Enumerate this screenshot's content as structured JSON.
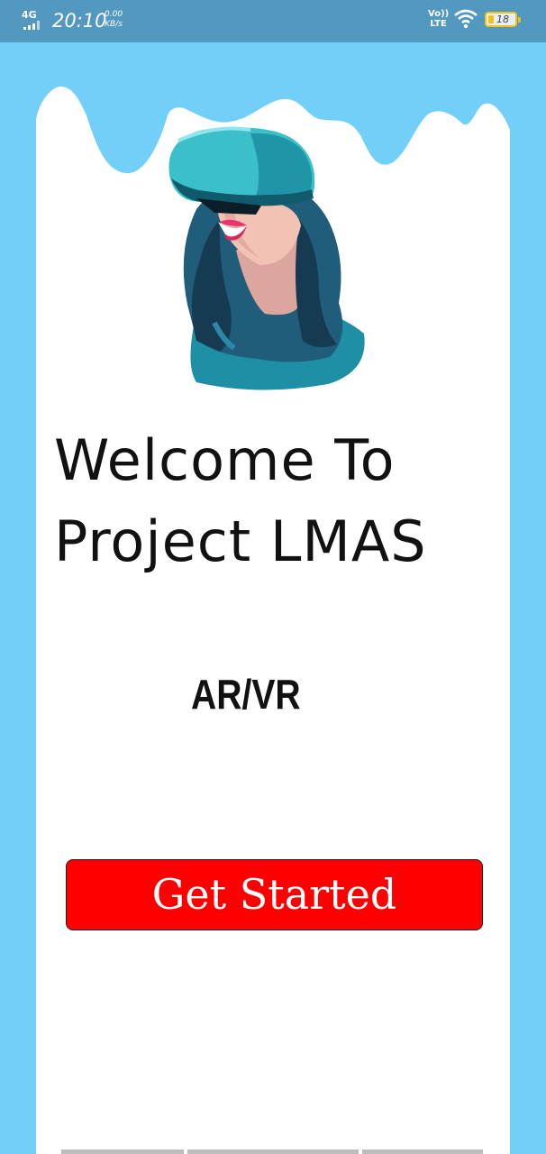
{
  "status_bar": {
    "network": "4G",
    "time": "20:10",
    "speed_value": "0.00",
    "speed_unit": "KB/s",
    "volte_top": "Vo))",
    "volte_bottom": "LTE",
    "battery": "18"
  },
  "main": {
    "title_line1": "Welcome To",
    "title_line2": "Project LMAS",
    "subtitle": "AR/VR",
    "cta_label": "Get Started"
  },
  "colors": {
    "background": "#71cff8",
    "status_bar": "#5398bf",
    "card": "#ffffff",
    "button": "#ff0000",
    "headset": "#3bbfc9"
  }
}
